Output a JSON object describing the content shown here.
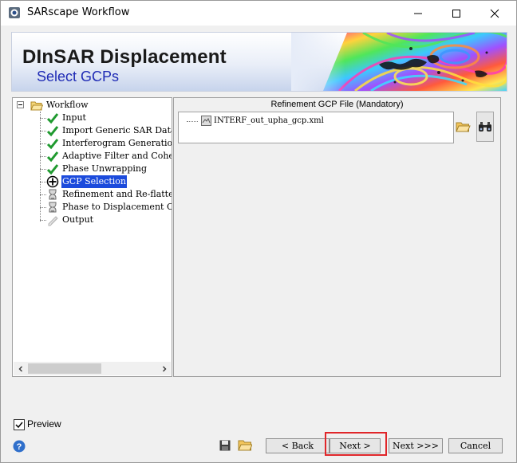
{
  "window": {
    "title": "SARscape Workflow",
    "icons": {
      "app": "sarscape-app-icon",
      "minimize": "minimize-icon",
      "maximize": "maximize-icon",
      "close": "close-icon"
    }
  },
  "banner": {
    "title": "DInSAR Displacement",
    "subtitle": "Select GCPs",
    "title_color": "#1a1a1a",
    "subtitle_color": "#1f2bb5"
  },
  "workflow_tree": {
    "root_label": "Workflow",
    "items": [
      {
        "label": "Input",
        "status": "done"
      },
      {
        "label": "Import Generic SAR Data",
        "status": "done"
      },
      {
        "label": "Interferogram Generation",
        "status": "done"
      },
      {
        "label": "Adaptive Filter and Coherence",
        "status": "done"
      },
      {
        "label": "Phase Unwrapping",
        "status": "done"
      },
      {
        "label": "GCP Selection",
        "status": "current"
      },
      {
        "label": "Refinement and Re-flattening",
        "status": "pending"
      },
      {
        "label": "Phase to Displacement Conversion",
        "status": "pending"
      },
      {
        "label": "Output",
        "status": "disabled"
      }
    ],
    "selection_color": "#1c4bdc"
  },
  "gcp_panel": {
    "label": "Refinement GCP File (Mandatory)",
    "files": [
      "INTERF_out_upha_gcp.xml"
    ]
  },
  "footer": {
    "preview_label": "Preview",
    "preview_checked": true,
    "buttons": {
      "back": "< Back",
      "next": "Next >",
      "next_all": "Next >>>",
      "cancel": "Cancel"
    },
    "highlight_color": "#e0262a"
  }
}
